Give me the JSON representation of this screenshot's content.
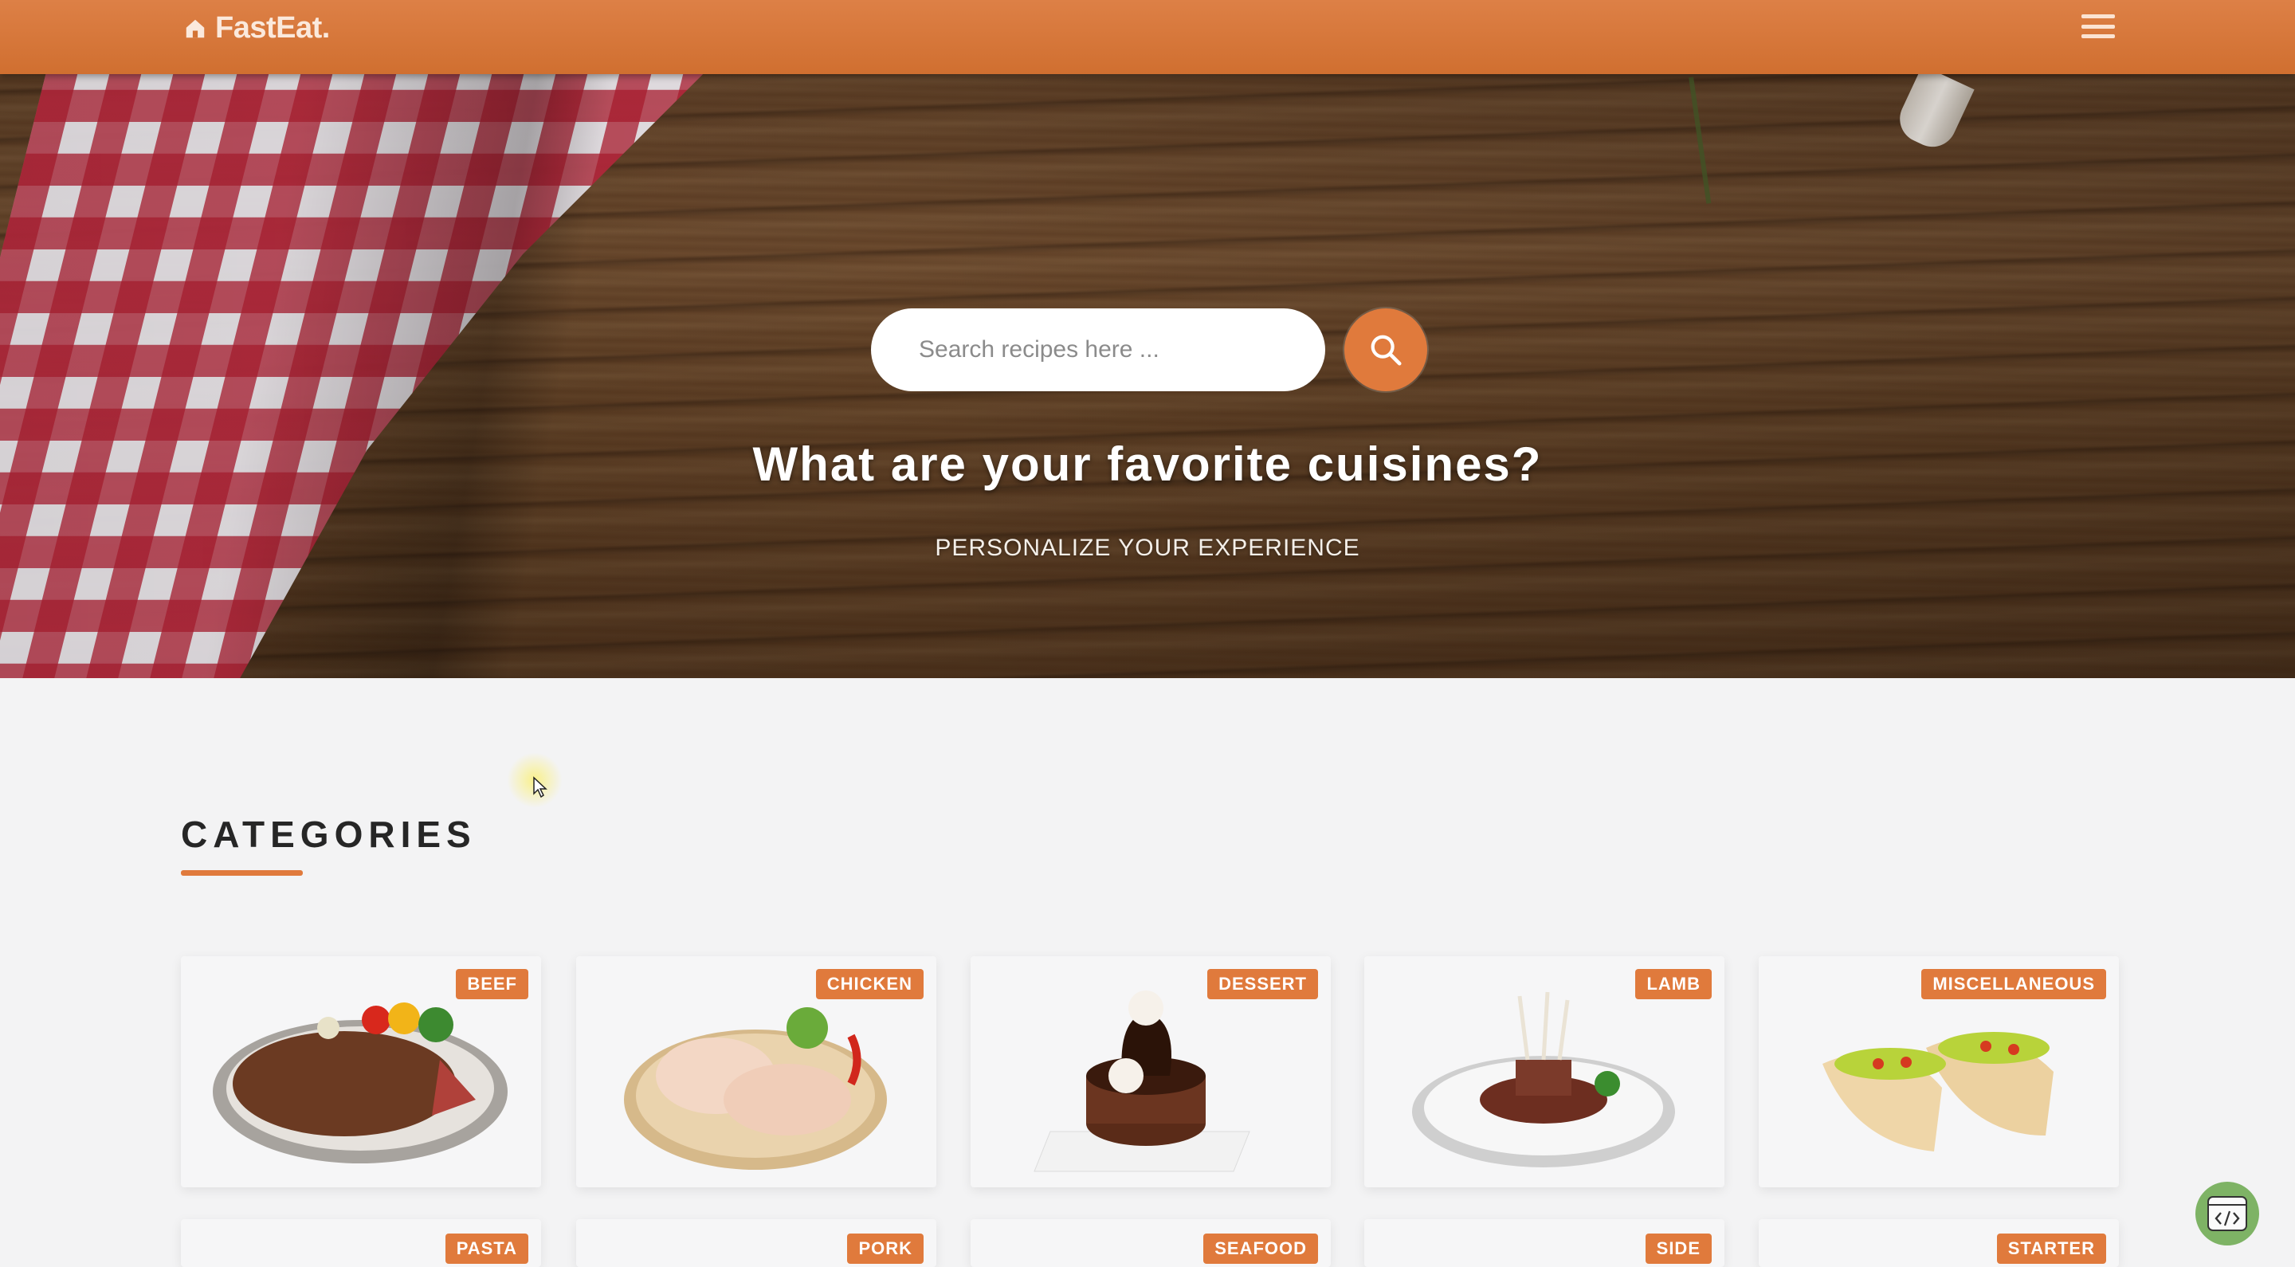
{
  "navbar": {
    "brand": "FastEat.",
    "home_icon": "home-icon",
    "menu_icon": "hamburger-icon"
  },
  "hero": {
    "search_placeholder": "Search recipes here ...",
    "search_icon": "search-icon",
    "title": "What are your favorite cuisines?",
    "subtitle": "PERSONALIZE YOUR EXPERIENCE"
  },
  "categories": {
    "title": "CATEGORIES",
    "items": [
      {
        "label": "BEEF"
      },
      {
        "label": "CHICKEN"
      },
      {
        "label": "DESSERT"
      },
      {
        "label": "LAMB"
      },
      {
        "label": "MISCELLANEOUS"
      },
      {
        "label": "PASTA"
      },
      {
        "label": "PORK"
      },
      {
        "label": "SEAFOOD"
      },
      {
        "label": "SIDE"
      },
      {
        "label": "STARTER"
      }
    ]
  },
  "colors": {
    "accent": "#e07a3c",
    "navbar": "#d37334",
    "embed_button": "#7eb365"
  },
  "embed_button_icon": "code-icon"
}
